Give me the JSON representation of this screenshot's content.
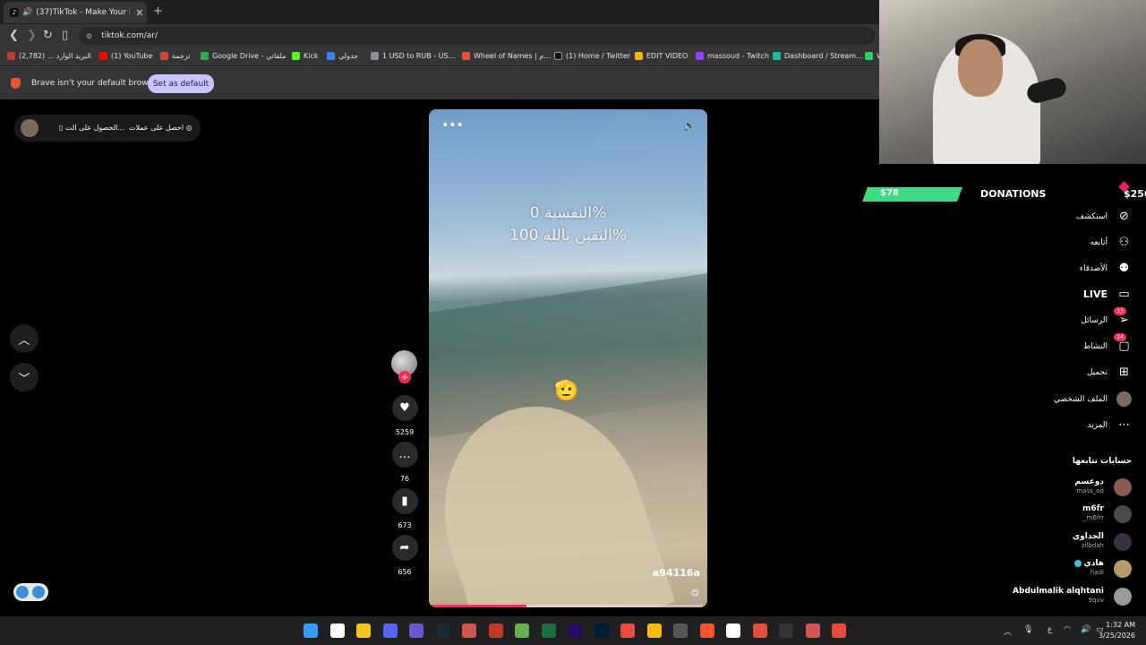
{
  "browser": {
    "tab_title": "(37)TikTok - Make Your Day",
    "tab_close": "✕",
    "new_tab": "+",
    "url": "tiktok.com/ar/",
    "bookmarks": [
      {
        "label": "البريد الوارد ... (2,782)",
        "color": "#c0392b"
      },
      {
        "label": "(1) YouTube",
        "color": "#ff0000"
      },
      {
        "label": "ترجمة",
        "color": "#d44638"
      },
      {
        "label": "Google Drive - ملفاتي",
        "color": "#34a853"
      },
      {
        "label": "Kick",
        "color": "#53fc18"
      },
      {
        "label": "جدولي",
        "color": "#3b82f6"
      },
      {
        "label": "1 USD to RUB - US...",
        "color": "#8e8ea0"
      },
      {
        "label": "Wheel of Names | م...",
        "color": "#e74c3c"
      },
      {
        "label": "(1) Home / Twitter",
        "color": "#111111"
      },
      {
        "label": "EDIT VIDEO",
        "color": "#f7b500"
      },
      {
        "label": "massoud - Twitch",
        "color": "#9146ff"
      },
      {
        "label": "Dashboard / Stream...",
        "color": "#1abc9c"
      },
      {
        "label": "W",
        "color": "#25d366"
      }
    ],
    "infobar_message": "Brave isn't your default browser",
    "set_default_label": "Set as default"
  },
  "tiktok": {
    "top_pill": {
      "get_coins": "احصل على عملات",
      "get_app": "الحصول على الت..."
    },
    "video": {
      "caption_line1": "النفسية 0%",
      "caption_line2": "اليقين بالله 100%",
      "username": "a94116a",
      "progress_fraction": 0.35,
      "menu": "•••",
      "emoji": "🫡",
      "smiley": "😊"
    },
    "actions": {
      "likes": "5259",
      "comments": "76",
      "saves": "673",
      "shares": "656"
    },
    "sidebar": {
      "explore": "استكشف",
      "friends": "أتابعه",
      "following": "الأصدقاء",
      "live": "LIVE",
      "messages": "الرسائل",
      "messages_badge": "13",
      "activity": "النشاط",
      "activity_badge": "24",
      "upload": "تحميل",
      "profile": "الملف الشخصي",
      "more": "المزيد",
      "following_accounts_title": "حسابات تتابعها",
      "accounts": [
        {
          "name": "دوعسم",
          "handle": "mass_od"
        },
        {
          "name": "m6fr",
          "handle": "_m6frr"
        },
        {
          "name": "الجداوي",
          "handle": "zilbdah"
        },
        {
          "name": "هادي",
          "handle": "hadi",
          "verified": true
        },
        {
          "name": "Abdulmalik alqhtani",
          "handle": "9quv"
        }
      ]
    }
  },
  "stream_overlay": {
    "donation_current": "$78",
    "donations_label": "DONATIONS",
    "donation_goal": "$250"
  },
  "taskbar": {
    "time": "1:32 AM",
    "date": "3/25/2026",
    "lang": "ع",
    "icons": [
      {
        "name": "windows-start",
        "color": "#3a9bff"
      },
      {
        "name": "search",
        "color": "#ffffff"
      },
      {
        "name": "file-explorer",
        "color": "#f5c518"
      },
      {
        "name": "discord",
        "color": "#5865f2"
      },
      {
        "name": "media-player",
        "color": "#6a5acd"
      },
      {
        "name": "steam",
        "color": "#1b2838"
      },
      {
        "name": "app-eu",
        "color": "#d35454"
      },
      {
        "name": "app-red",
        "color": "#c0392b"
      },
      {
        "name": "app-green",
        "color": "#6ab04c"
      },
      {
        "name": "excel",
        "color": "#1d6f42"
      },
      {
        "name": "premiere",
        "color": "#2a0b5c"
      },
      {
        "name": "photoshop",
        "color": "#001e36"
      },
      {
        "name": "app-red-2",
        "color": "#e74c3c"
      },
      {
        "name": "chrome",
        "color": "#fbbc05"
      },
      {
        "name": "app-circle",
        "color": "#555555"
      },
      {
        "name": "brave",
        "color": "#fb542b"
      },
      {
        "name": "capcut",
        "color": "#ffffff"
      },
      {
        "name": "app-cc",
        "color": "#e74c3c"
      },
      {
        "name": "app-box",
        "color": "#333333"
      },
      {
        "name": "app-eu-2",
        "color": "#d35454"
      },
      {
        "name": "app-cc-2",
        "color": "#e74c3c"
      }
    ]
  }
}
